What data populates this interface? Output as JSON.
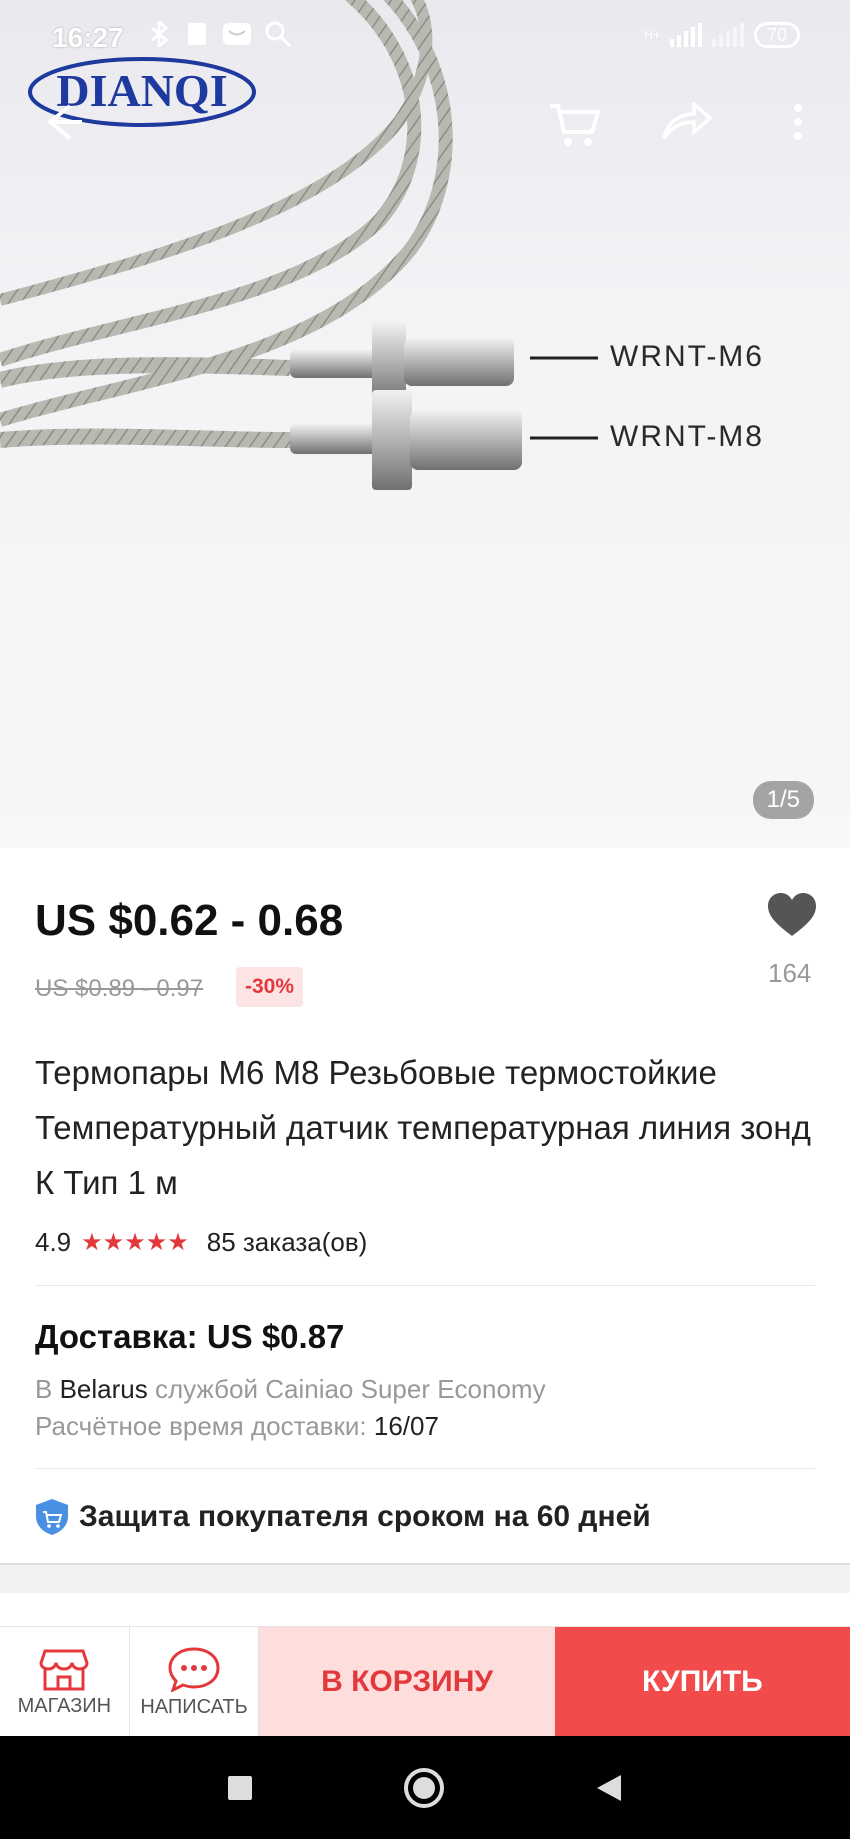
{
  "status_bar": {
    "time": "16:27",
    "battery": "70",
    "network": "H+"
  },
  "brand": {
    "logo_text": "DIANQI"
  },
  "gallery": {
    "counter": "1/5",
    "labels": [
      "WRNT-M6",
      "WRNT-M8"
    ]
  },
  "product": {
    "price": "US $0.62 - 0.68",
    "old_price": "US $0.89 - 0.97",
    "discount": "-30%",
    "favorites": "164",
    "title": "Термопары М6 М8 Резьбовые термостойкие Температурный датчик температурная линия зонд К Тип 1 м",
    "rating": "4.9",
    "stars": "★★★★★",
    "orders": "85 заказа(ов)"
  },
  "shipping": {
    "title": "Доставка: US $0.87",
    "to_prefix": "В",
    "country": "Belarus",
    "service": "службой Cainiao Super Economy",
    "eta_label": "Расчётное время доставки:",
    "eta_value": "16/07"
  },
  "protection": {
    "text": "Защита покупателя сроком на 60 дней"
  },
  "actions": {
    "store": "МАГАЗИН",
    "message": "НАПИСАТЬ",
    "add_to_cart": "В КОРЗИНУ",
    "buy": "КУПИТЬ"
  },
  "colors": {
    "accent": "#e4393c",
    "cart_bg": "#fddedd",
    "buy_bg": "#f24b4b"
  }
}
